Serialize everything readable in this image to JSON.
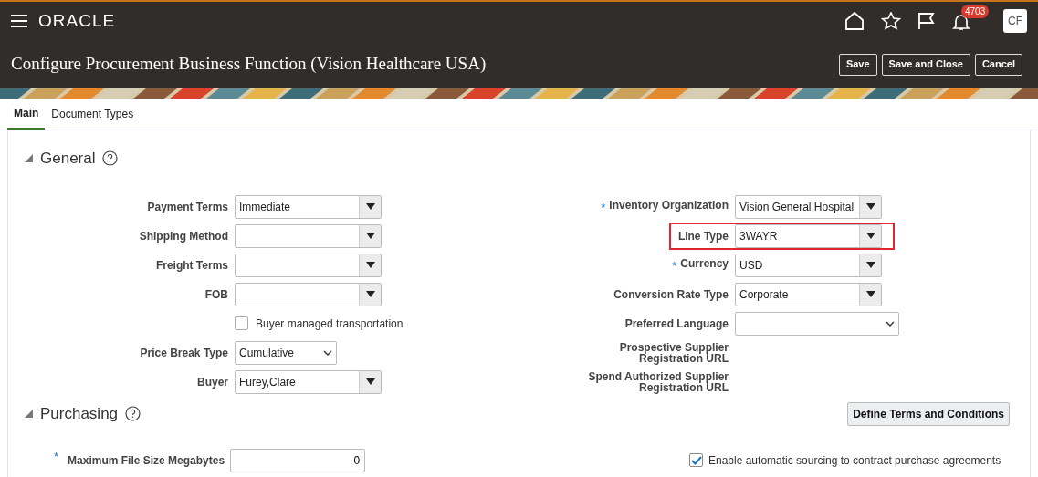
{
  "header": {
    "brand": "ORACLE",
    "notification_count": "4703",
    "avatar": "CF"
  },
  "page_title": "Configure Procurement Business Function (Vision Healthcare USA)",
  "buttons": [
    "Save",
    "Save and Close",
    "Cancel"
  ],
  "tabs": [
    {
      "label": "Main",
      "selected": true
    },
    {
      "label": "Document Types",
      "selected": false
    }
  ],
  "general": {
    "title": "General",
    "expanded": true,
    "left_fields": [
      {
        "kind": "combo",
        "label": "Payment Terms",
        "value": "Immediate"
      },
      {
        "kind": "combo",
        "label": "Shipping Method"
      },
      {
        "kind": "combo",
        "label": "Freight Terms"
      },
      {
        "kind": "combo",
        "label": "FOB"
      },
      {
        "kind": "checkbox",
        "label": "Buyer managed transportation",
        "checked": false
      },
      {
        "kind": "select",
        "label": "Price Break Type",
        "value": "Cumulative"
      },
      {
        "kind": "combo",
        "label": "Buyer",
        "value": "Furey,Clare"
      }
    ],
    "right_fields": [
      {
        "kind": "combo",
        "label": "Inventory Organization",
        "value": "Vision General Hospital",
        "required_mark": "*",
        "highlighted": false
      },
      {
        "kind": "combo",
        "label": "Line Type",
        "value": "3WAYR",
        "highlighted": true
      },
      {
        "kind": "combo",
        "label": "Currency",
        "value": "USD",
        "required_mark": "*",
        "highlighted": false
      },
      {
        "kind": "combo",
        "label": "Conversion Rate Type",
        "value": "Corporate",
        "highlighted": false
      },
      {
        "kind": "wideselect",
        "label": "Preferred Language",
        "highlighted": false
      },
      {
        "kind": "readonly",
        "label": "Prospective Supplier Registration URL",
        "highlighted": false
      },
      {
        "kind": "readonly",
        "label": "Spend Authorized Supplier Registration URL",
        "highlighted": false
      }
    ]
  },
  "purchasing": {
    "title": "Purchasing",
    "expanded": true,
    "action_button": "Define Terms and Conditions",
    "max_file_size": {
      "label": "Maximum File Size Megabytes",
      "value": "0",
      "required_mark": "*"
    },
    "auto_sourcing": {
      "label": "Enable automatic sourcing to contract purchase agreements",
      "checked": true
    }
  }
}
